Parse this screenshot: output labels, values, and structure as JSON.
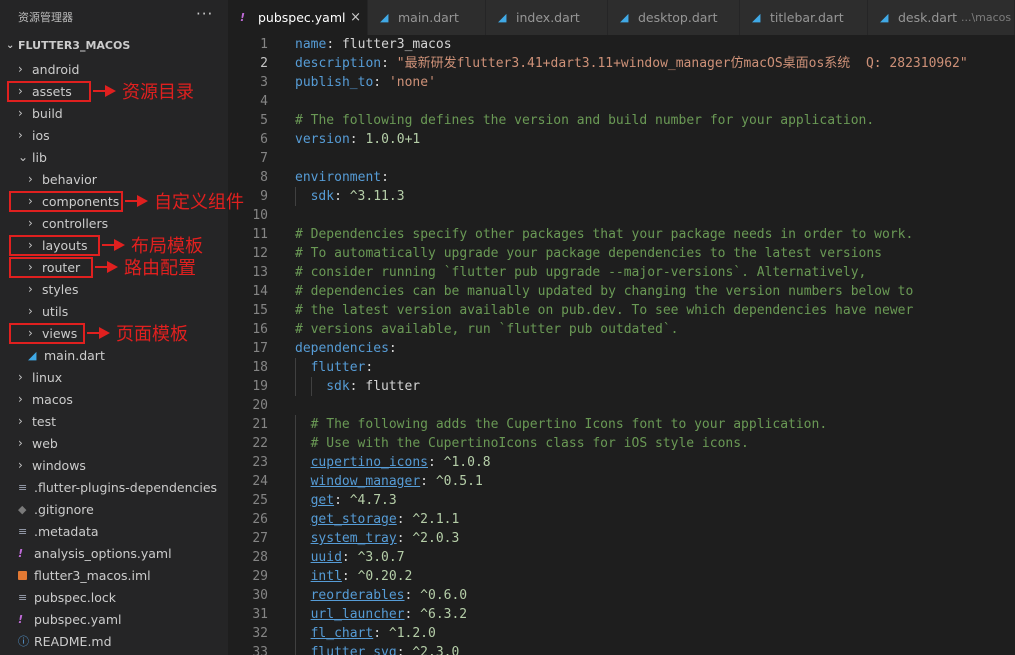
{
  "explorer": {
    "title": "资源管理器",
    "more": "···",
    "root": "FLUTTER3_MACOS",
    "items": [
      {
        "label": "android",
        "kind": "folder",
        "depth": 0,
        "chevron": "›",
        "icon": ""
      },
      {
        "label": "assets",
        "kind": "folder",
        "depth": 0,
        "chevron": "›",
        "icon": ""
      },
      {
        "label": "build",
        "kind": "folder",
        "depth": 0,
        "chevron": "›",
        "icon": ""
      },
      {
        "label": "ios",
        "kind": "folder",
        "depth": 0,
        "chevron": "›",
        "icon": ""
      },
      {
        "label": "lib",
        "kind": "folder-open",
        "depth": 0,
        "chevron": "⌄",
        "icon": ""
      },
      {
        "label": "behavior",
        "kind": "folder",
        "depth": 1,
        "chevron": "›",
        "icon": ""
      },
      {
        "label": "components",
        "kind": "folder",
        "depth": 1,
        "chevron": "›",
        "icon": ""
      },
      {
        "label": "controllers",
        "kind": "folder",
        "depth": 1,
        "chevron": "›",
        "icon": ""
      },
      {
        "label": "layouts",
        "kind": "folder",
        "depth": 1,
        "chevron": "›",
        "icon": ""
      },
      {
        "label": "router",
        "kind": "folder",
        "depth": 1,
        "chevron": "›",
        "icon": ""
      },
      {
        "label": "styles",
        "kind": "folder",
        "depth": 1,
        "chevron": "›",
        "icon": ""
      },
      {
        "label": "utils",
        "kind": "folder",
        "depth": 1,
        "chevron": "›",
        "icon": ""
      },
      {
        "label": "views",
        "kind": "folder",
        "depth": 1,
        "chevron": "›",
        "icon": ""
      },
      {
        "label": "main.dart",
        "kind": "file",
        "depth": 1,
        "chevron": "",
        "icon": "dart"
      },
      {
        "label": "linux",
        "kind": "folder",
        "depth": 0,
        "chevron": "›",
        "icon": ""
      },
      {
        "label": "macos",
        "kind": "folder",
        "depth": 0,
        "chevron": "›",
        "icon": ""
      },
      {
        "label": "test",
        "kind": "folder",
        "depth": 0,
        "chevron": "›",
        "icon": ""
      },
      {
        "label": "web",
        "kind": "folder",
        "depth": 0,
        "chevron": "›",
        "icon": ""
      },
      {
        "label": "windows",
        "kind": "folder",
        "depth": 0,
        "chevron": "›",
        "icon": ""
      },
      {
        "label": ".flutter-plugins-dependencies",
        "kind": "file",
        "depth": 0,
        "chevron": "",
        "icon": "doc"
      },
      {
        "label": ".gitignore",
        "kind": "file",
        "depth": 0,
        "chevron": "",
        "icon": "git"
      },
      {
        "label": ".metadata",
        "kind": "file",
        "depth": 0,
        "chevron": "",
        "icon": "doc"
      },
      {
        "label": "analysis_options.yaml",
        "kind": "file",
        "depth": 0,
        "chevron": "",
        "icon": "yaml"
      },
      {
        "label": "flutter3_macos.iml",
        "kind": "file",
        "depth": 0,
        "chevron": "",
        "icon": "rss"
      },
      {
        "label": "pubspec.lock",
        "kind": "file",
        "depth": 0,
        "chevron": "",
        "icon": "doc"
      },
      {
        "label": "pubspec.yaml",
        "kind": "file",
        "depth": 0,
        "chevron": "",
        "icon": "yaml"
      },
      {
        "label": "README.md",
        "kind": "file",
        "depth": 0,
        "chevron": "",
        "icon": "info"
      }
    ]
  },
  "annotations": [
    {
      "text": "资源目录",
      "target": "assets"
    },
    {
      "text": "自定义组件",
      "target": "components"
    },
    {
      "text": "布局模板",
      "target": "layouts"
    },
    {
      "text": "路由配置",
      "target": "router"
    },
    {
      "text": "页面模板",
      "target": "views"
    }
  ],
  "tabs": [
    {
      "label": "pubspec.yaml",
      "icon": "yaml",
      "active": true,
      "close": "×",
      "path": ""
    },
    {
      "label": "main.dart",
      "icon": "dart",
      "active": false,
      "close": "",
      "path": ""
    },
    {
      "label": "index.dart",
      "icon": "dart",
      "active": false,
      "close": "",
      "path": ""
    },
    {
      "label": "desktop.dart",
      "icon": "dart",
      "active": false,
      "close": "",
      "path": ""
    },
    {
      "label": "titlebar.dart",
      "icon": "dart",
      "active": false,
      "close": "",
      "path": ""
    },
    {
      "label": "desk.dart",
      "icon": "dart",
      "active": false,
      "close": "",
      "path": "...\\macos"
    }
  ],
  "editor": {
    "current_line": 2,
    "lines": [
      {
        "n": "1",
        "tokens": [
          [
            "k",
            "name"
          ],
          [
            "p",
            ": "
          ],
          [
            "p",
            "flutter3_macos"
          ]
        ]
      },
      {
        "n": "2",
        "tokens": [
          [
            "k",
            "description"
          ],
          [
            "p",
            ": "
          ],
          [
            "s",
            "\"最新研发flutter3.41+dart3.11+window_manager仿macOS桌面os系统  Q: 282310962\""
          ]
        ]
      },
      {
        "n": "3",
        "tokens": [
          [
            "k",
            "publish_to"
          ],
          [
            "p",
            ": "
          ],
          [
            "s",
            "'none'"
          ]
        ]
      },
      {
        "n": "4",
        "tokens": []
      },
      {
        "n": "5",
        "tokens": [
          [
            "c",
            "# The following defines the version and build number for your application."
          ]
        ]
      },
      {
        "n": "6",
        "tokens": [
          [
            "k",
            "version"
          ],
          [
            "p",
            ": "
          ],
          [
            "n",
            "1.0.0+1"
          ]
        ]
      },
      {
        "n": "7",
        "tokens": []
      },
      {
        "n": "8",
        "tokens": [
          [
            "k",
            "environment"
          ],
          [
            "p",
            ":"
          ]
        ]
      },
      {
        "n": "9",
        "indent": 1,
        "tokens": [
          [
            "k",
            "sdk"
          ],
          [
            "p",
            ": "
          ],
          [
            "n",
            "^3.11.3"
          ]
        ]
      },
      {
        "n": "10",
        "tokens": []
      },
      {
        "n": "11",
        "tokens": [
          [
            "c",
            "# Dependencies specify other packages that your package needs in order to work."
          ]
        ]
      },
      {
        "n": "12",
        "tokens": [
          [
            "c",
            "# To automatically upgrade your package dependencies to the latest versions"
          ]
        ]
      },
      {
        "n": "13",
        "tokens": [
          [
            "c",
            "# consider running `flutter pub upgrade --major-versions`. Alternatively,"
          ]
        ]
      },
      {
        "n": "14",
        "tokens": [
          [
            "c",
            "# dependencies can be manually updated by changing the version numbers below to"
          ]
        ]
      },
      {
        "n": "15",
        "tokens": [
          [
            "c",
            "# the latest version available on pub.dev. To see which dependencies have newer"
          ]
        ]
      },
      {
        "n": "16",
        "tokens": [
          [
            "c",
            "# versions available, run `flutter pub outdated`."
          ]
        ]
      },
      {
        "n": "17",
        "tokens": [
          [
            "k",
            "dependencies"
          ],
          [
            "p",
            ":"
          ]
        ]
      },
      {
        "n": "18",
        "indent": 1,
        "tokens": [
          [
            "k",
            "flutter"
          ],
          [
            "p",
            ":"
          ]
        ]
      },
      {
        "n": "19",
        "indent": 2,
        "tokens": [
          [
            "k",
            "sdk"
          ],
          [
            "p",
            ": "
          ],
          [
            "p",
            "flutter"
          ]
        ]
      },
      {
        "n": "20",
        "tokens": []
      },
      {
        "n": "21",
        "indent": 1,
        "tokens": [
          [
            "c",
            "# The following adds the Cupertino Icons font to your application."
          ]
        ]
      },
      {
        "n": "22",
        "indent": 1,
        "tokens": [
          [
            "c",
            "# Use with the CupertinoIcons class for iOS style icons."
          ]
        ]
      },
      {
        "n": "23",
        "indent": 1,
        "tokens": [
          [
            "u",
            "cupertino_icons"
          ],
          [
            "p",
            ": "
          ],
          [
            "n",
            "^1.0.8"
          ]
        ]
      },
      {
        "n": "24",
        "indent": 1,
        "tokens": [
          [
            "u",
            "window_manager"
          ],
          [
            "p",
            ": "
          ],
          [
            "n",
            "^0.5.1"
          ]
        ]
      },
      {
        "n": "25",
        "indent": 1,
        "tokens": [
          [
            "u",
            "get"
          ],
          [
            "p",
            ": "
          ],
          [
            "n",
            "^4.7.3"
          ]
        ]
      },
      {
        "n": "26",
        "indent": 1,
        "tokens": [
          [
            "u",
            "get_storage"
          ],
          [
            "p",
            ": "
          ],
          [
            "n",
            "^2.1.1"
          ]
        ]
      },
      {
        "n": "27",
        "indent": 1,
        "tokens": [
          [
            "u",
            "system_tray"
          ],
          [
            "p",
            ": "
          ],
          [
            "n",
            "^2.0.3"
          ]
        ]
      },
      {
        "n": "28",
        "indent": 1,
        "tokens": [
          [
            "u",
            "uuid"
          ],
          [
            "p",
            ": "
          ],
          [
            "n",
            "^3.0.7"
          ]
        ]
      },
      {
        "n": "29",
        "indent": 1,
        "tokens": [
          [
            "u",
            "intl"
          ],
          [
            "p",
            ": "
          ],
          [
            "n",
            "^0.20.2"
          ]
        ]
      },
      {
        "n": "30",
        "indent": 1,
        "tokens": [
          [
            "u",
            "reorderables"
          ],
          [
            "p",
            ": "
          ],
          [
            "n",
            "^0.6.0"
          ]
        ]
      },
      {
        "n": "31",
        "indent": 1,
        "tokens": [
          [
            "u",
            "url_launcher"
          ],
          [
            "p",
            ": "
          ],
          [
            "n",
            "^6.3.2"
          ]
        ]
      },
      {
        "n": "32",
        "indent": 1,
        "tokens": [
          [
            "u",
            "fl_chart"
          ],
          [
            "p",
            ": "
          ],
          [
            "n",
            "^1.2.0"
          ]
        ]
      },
      {
        "n": "33",
        "indent": 1,
        "tokens": [
          [
            "u",
            "flutter_svg"
          ],
          [
            "p",
            ": "
          ],
          [
            "n",
            "^2.3.0"
          ]
        ]
      }
    ]
  },
  "colors": {
    "annotation_red": "#e0201f",
    "keyword": "#569cd6",
    "string": "#ce9178",
    "number": "#b5cea8",
    "comment": "#6a9955"
  }
}
